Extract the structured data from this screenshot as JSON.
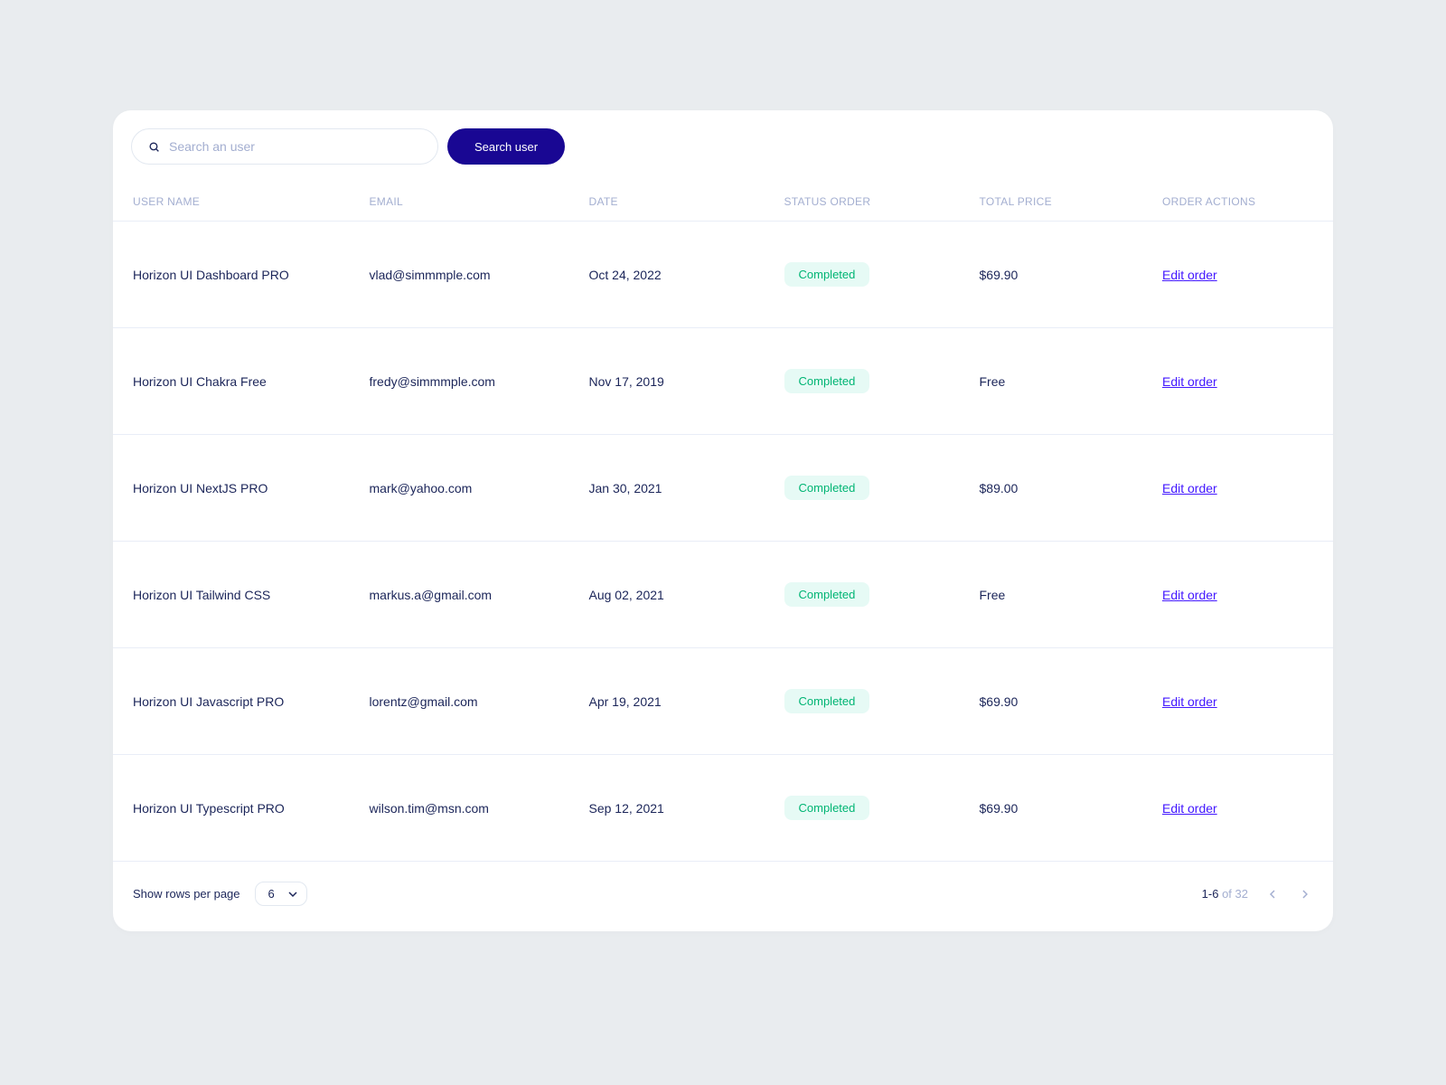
{
  "search": {
    "placeholder": "Search an user",
    "button_label": "Search user"
  },
  "columns": {
    "name": "USER NAME",
    "email": "EMAIL",
    "date": "DATE",
    "status": "STATUS ORDER",
    "price": "TOTAL PRICE",
    "actions": "ORDER ACTIONS"
  },
  "rows": [
    {
      "name": "Horizon UI Dashboard PRO",
      "email": "vlad@simmmple.com",
      "date": "Oct 24, 2022",
      "status": "Completed",
      "price": "$69.90",
      "action": "Edit order"
    },
    {
      "name": "Horizon UI Chakra Free",
      "email": "fredy@simmmple.com",
      "date": "Nov 17, 2019",
      "status": "Completed",
      "price": "Free",
      "action": "Edit order"
    },
    {
      "name": "Horizon UI NextJS PRO",
      "email": "mark@yahoo.com",
      "date": "Jan 30, 2021",
      "status": "Completed",
      "price": "$89.00",
      "action": "Edit order"
    },
    {
      "name": "Horizon UI Tailwind CSS",
      "email": "markus.a@gmail.com",
      "date": "Aug 02, 2021",
      "status": "Completed",
      "price": "Free",
      "action": "Edit order"
    },
    {
      "name": "Horizon UI Javascript PRO",
      "email": "lorentz@gmail.com",
      "date": "Apr 19, 2021",
      "status": "Completed",
      "price": "$69.90",
      "action": "Edit order"
    },
    {
      "name": "Horizon UI Typescript PRO",
      "email": "wilson.tim@msn.com",
      "date": "Sep 12, 2021",
      "status": "Completed",
      "price": "$69.90",
      "action": "Edit order"
    }
  ],
  "pagination": {
    "rows_label": "Show rows per page",
    "rows_value": "6",
    "range": "1-6",
    "of_label": " of ",
    "total": "32"
  }
}
